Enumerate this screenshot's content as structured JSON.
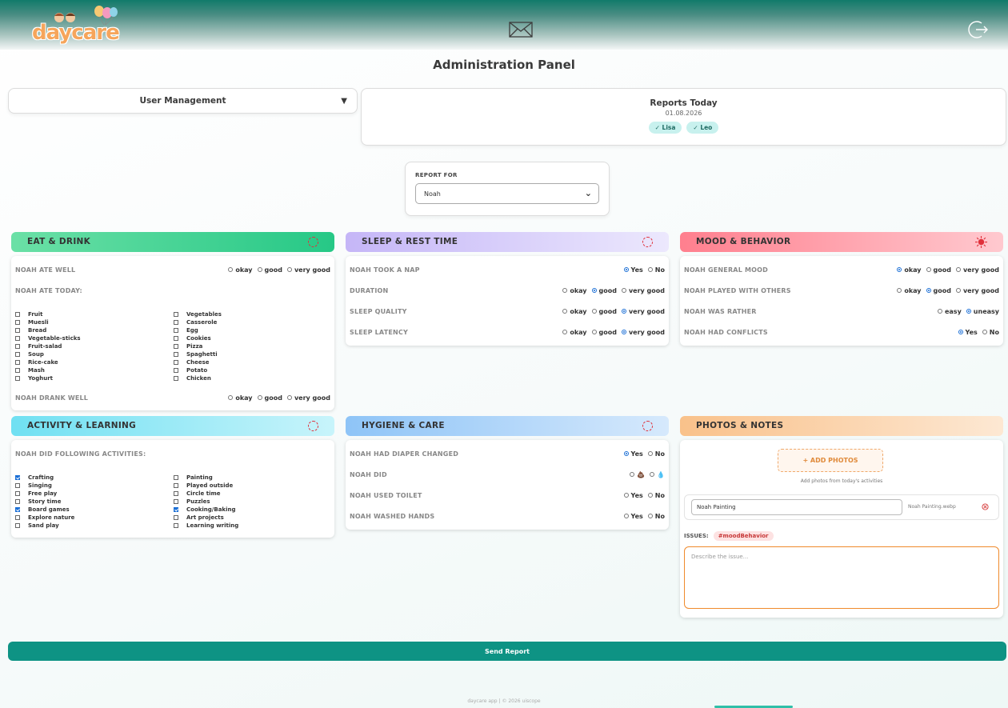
{
  "header": {
    "logo_text": "daycare",
    "mail_icon": "mail-icon",
    "logout_icon": "logout-icon"
  },
  "page_title": "Administration Panel",
  "user_management": {
    "label": "User Management"
  },
  "reports_today": {
    "title": "Reports Today",
    "date": "01.08.2026",
    "children": [
      "✓ Lisa",
      "✓ Leo"
    ]
  },
  "report_for": {
    "label": "REPORT FOR",
    "selected": "Noah"
  },
  "eat": {
    "title": "EAT & DRINK",
    "ate_well": {
      "label": "NOAH ATE WELL",
      "options": [
        "okay",
        "good",
        "very good"
      ],
      "selected": -1
    },
    "ate_today_label": "NOAH ATE TODAY:",
    "foods_left": [
      "Fruit",
      "Muesli",
      "Bread",
      "Vegetable-sticks",
      "Fruit-salad",
      "Soup",
      "Rice-cake",
      "Mash",
      "Yoghurt"
    ],
    "foods_right": [
      "Vegetables",
      "Casserole",
      "Egg",
      "Cookies",
      "Pizza",
      "Spaghetti",
      "Cheese",
      "Potato",
      "Chicken"
    ],
    "drank_well": {
      "label": "NOAH DRANK WELL",
      "options": [
        "okay",
        "good",
        "very good"
      ],
      "selected": -1
    }
  },
  "sleep": {
    "title": "SLEEP & REST TIME",
    "rows": [
      {
        "label": "NOAH TOOK A NAP",
        "options": [
          "Yes",
          "No"
        ],
        "selected": 0
      },
      {
        "label": "DURATION",
        "options": [
          "okay",
          "good",
          "very good"
        ],
        "selected": 1
      },
      {
        "label": "SLEEP QUALITY",
        "options": [
          "okay",
          "good",
          "very good"
        ],
        "selected": 2
      },
      {
        "label": "SLEEP LATENCY",
        "options": [
          "okay",
          "good",
          "very good"
        ],
        "selected": 2
      }
    ]
  },
  "mood": {
    "title": "MOOD & BEHAVIOR",
    "rows": [
      {
        "label": "NOAH GENERAL MOOD",
        "options": [
          "okay",
          "good",
          "very good"
        ],
        "selected": 0
      },
      {
        "label": "NOAH PLAYED WITH OTHERS",
        "options": [
          "okay",
          "good",
          "very good"
        ],
        "selected": 1
      },
      {
        "label": "NOAH WAS RATHER",
        "options": [
          "easy",
          "uneasy"
        ],
        "selected": 1
      },
      {
        "label": "NOAH HAD CONFLICTS",
        "options": [
          "Yes",
          "No"
        ],
        "selected": 0
      }
    ]
  },
  "activity": {
    "title": "ACTIVITY & LEARNING",
    "label": "NOAH DID FOLLOWING ACTIVITIES:",
    "left": [
      {
        "name": "Crafting",
        "checked": true
      },
      {
        "name": "Singing",
        "checked": false
      },
      {
        "name": "Free play",
        "checked": false
      },
      {
        "name": "Story time",
        "checked": false
      },
      {
        "name": "Board games",
        "checked": true
      },
      {
        "name": "Explore nature",
        "checked": false
      },
      {
        "name": "Sand play",
        "checked": false
      }
    ],
    "right": [
      {
        "name": "Painting",
        "checked": false
      },
      {
        "name": "Played outside",
        "checked": false
      },
      {
        "name": "Circle time",
        "checked": false
      },
      {
        "name": "Puzzles",
        "checked": false
      },
      {
        "name": "Cooking/Baking",
        "checked": true
      },
      {
        "name": "Art projects",
        "checked": false
      },
      {
        "name": "Learning writing",
        "checked": false
      }
    ]
  },
  "hygiene": {
    "title": "HYGIENE & CARE",
    "rows": [
      {
        "label": "NOAH HAD DIAPER CHANGED",
        "options": [
          "Yes",
          "No"
        ],
        "selected": 0
      },
      {
        "label": "NOAH DID",
        "options": [
          "💩",
          "💧"
        ],
        "selected": -1
      },
      {
        "label": "NOAH USED TOILET",
        "options": [
          "Yes",
          "No"
        ],
        "selected": -1
      },
      {
        "label": "NOAH WASHED HANDS",
        "options": [
          "Yes",
          "No"
        ],
        "selected": -1
      }
    ]
  },
  "photos": {
    "title": "PHOTOS & NOTES",
    "add_label": "+ ADD PHOTOS",
    "add_hint": "Add photos from today's activities",
    "caption": "Noah Painting",
    "file_name": "Noah Painting.webp",
    "issues_label": "ISSUES:",
    "issue_tag": "#moodBehavior",
    "issue_placeholder": "Describe the issue..."
  },
  "send_label": "Send Report",
  "footer": "daycare app | © 2026 uiscope",
  "colors": {
    "accent": "#0e9384",
    "selected_radio": "#1b6fd6",
    "issue_border": "#f08a2c"
  }
}
